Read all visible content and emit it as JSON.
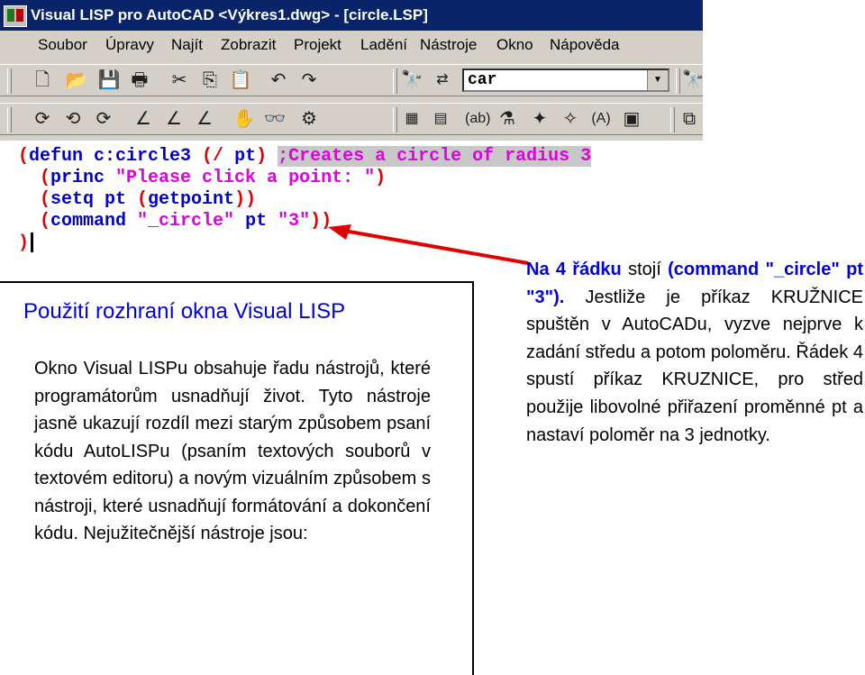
{
  "window": {
    "title": "Visual LISP pro AutoCAD <Výkres1.dwg> - [circle.LSP]",
    "menu": [
      "Soubor",
      "Úpravy",
      "Najít",
      "Zobrazit",
      "Projekt",
      "Ladění",
      "Nástroje",
      "Okno",
      "Nápověda"
    ],
    "find_combo_value": "car",
    "icons": {
      "toolbar1": [
        "new-file-icon",
        "open-file-icon",
        "save-icon",
        "print-icon",
        "cut-icon",
        "copy-icon",
        "paste-icon",
        "undo-icon",
        "redo-icon",
        "find-icon",
        "replace-icon",
        "find-combo",
        "find-toolbar-icon",
        "toggle-bookmark-icon"
      ],
      "toolbar2": [
        "load-active-window-icon",
        "load-selected-text-icon",
        "load-text-icon",
        "indent-icon",
        "outdent-icon",
        "format-icon",
        "select-object-icon",
        "inspect-icon",
        "watch-icon",
        "activate-autocad-icon",
        "load-window-icon",
        "check-icon",
        "apropos-icon",
        "help-icon",
        "inspect-window-icon",
        "symbol-service-icon",
        "trace-icon",
        "console-icon",
        "visual-lisp-console-icon"
      ]
    },
    "colors": {
      "titlebar": "#0a246a",
      "window_bg": "#d4d0c8",
      "paren": "#e00000",
      "keyword": "#0000d0",
      "string": "#e000e0",
      "comment_bg": "#c8c8c8"
    }
  },
  "code": {
    "line1": {
      "p1": "(",
      "kw": "defun c:circle3 ",
      "p2": "(/ ",
      "args": "pt",
      "p3": ")",
      "sp": " ",
      "comment": ";Creates a circle of radius 3"
    },
    "line2": {
      "p1": "(",
      "kw": "princ ",
      "str": "\"Please click a point: \"",
      "p2": ")"
    },
    "line3": {
      "p1": "(",
      "kw": "setq pt ",
      "p2": "(",
      "kw2": "getpoint",
      "p3": "))"
    },
    "line4": {
      "p1": "(",
      "kw": "command ",
      "str": "\"_circle\"",
      "mid": " pt ",
      "str2": "\"3\"",
      "p2": "))"
    },
    "line5": {
      "p1": ")"
    }
  },
  "left_panel": {
    "title": "Použití rozhraní okna Visual LISP",
    "body": "Okno Visual LISPu obsahuje řadu nástrojů, které programátorům usnadňují život. Tyto nástroje jasně ukazují rozdíl mezi starým způsobem psaní kódu AutoLISPu (psaním textových souborů v textovém editoru) a novým vizuálním způsobem s nástroji, které usnadňují formátování a dokončení kódu. Nejužitečnější nástroje jsou:"
  },
  "right_panel": {
    "highlight": "Na 4 řádku",
    "text1": " stojí ",
    "highlight2": "(command \"_circle\" pt \"3\").",
    "text2": " Jestliže je příkaz KRUŽNICE spuštěn v AutoCADu, vyzve nejprve k zadání středu a potom poloměru. Řádek 4 spustí příkaz KRUZNICE, pro střed použije libovolné přiřazení proměnné pt a nastaví poloměr na 3 jednotky."
  }
}
